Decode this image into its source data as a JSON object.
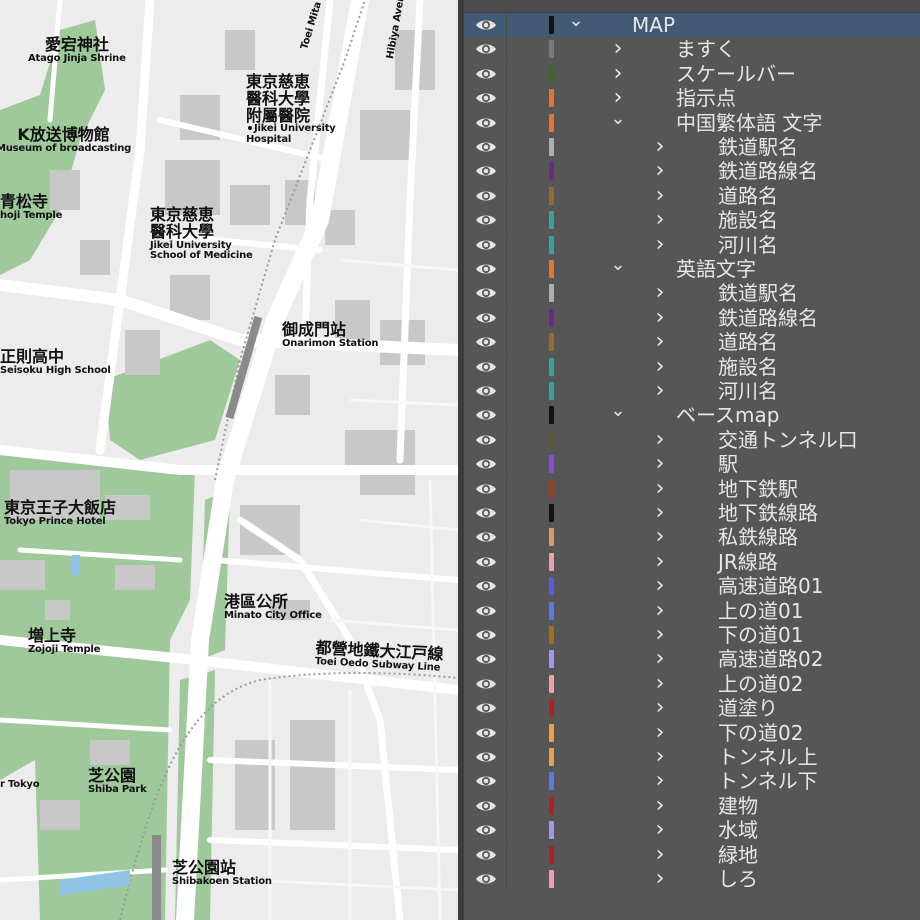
{
  "colors": {
    "panel_bg": "#565656",
    "selected_row": "#425a75",
    "map_bg": "#ececec",
    "park": "#9fc99a",
    "building": "#c8c8c8",
    "road": "#ffffff"
  },
  "map": {
    "labels": [
      {
        "id": "atago",
        "jp": "愛宕神社",
        "en": "Atago Jinja Shrine"
      },
      {
        "id": "broadcast",
        "jp": "K放送博物館",
        "en": "Museum of broadcasting"
      },
      {
        "id": "seishoji",
        "jp": "青松寺",
        "en": "hoji Temple"
      },
      {
        "id": "jikei_hosp",
        "jp": "東京慈恵\n醫科大學\n附屬醫院",
        "en": "Jikei University\nHospital"
      },
      {
        "id": "jikei_med",
        "jp": "東京慈恵\n醫科大學",
        "en": "Jikei University\nSchool of Medicine"
      },
      {
        "id": "seisoku",
        "jp": "正則高中",
        "en": "Seisoku High School"
      },
      {
        "id": "onarimon",
        "jp": "御成門站",
        "en": "Onarimon Station"
      },
      {
        "id": "prince",
        "jp": "東京王子大飯店",
        "en": "Tokyo Prince Hotel"
      },
      {
        "id": "minato",
        "jp": "港區公所",
        "en": "Minato City Office"
      },
      {
        "id": "oedo",
        "jp": "都營地鐵大江戸線",
        "en": "Toei Oedo Subway Line"
      },
      {
        "id": "zojoji",
        "jp": "増上寺",
        "en": "Zojoji Temple"
      },
      {
        "id": "shibapark",
        "jp": "芝公園",
        "en": "Shiba Park"
      },
      {
        "id": "rtokyo",
        "jp": "",
        "en": "r Tokyo"
      },
      {
        "id": "shibakoen",
        "jp": "芝公園站",
        "en": "Shibakoen Station"
      }
    ],
    "rotated": {
      "mita": "Toei Mita Subway Line",
      "hibiya": "Hibiya Avenue"
    }
  },
  "layers": [
    {
      "name": "MAP",
      "level": 0,
      "expanded": true,
      "color": "#111111",
      "selected": true
    },
    {
      "name": "ますく",
      "level": 1,
      "expanded": false,
      "color": "#7a7a7a"
    },
    {
      "name": "スケールバー",
      "level": 1,
      "expanded": false,
      "color": "#3c6a24"
    },
    {
      "name": "指示点",
      "level": 1,
      "expanded": false,
      "color": "#e8732c"
    },
    {
      "name": "中国繁体語 文字",
      "level": 1,
      "expanded": true,
      "color": "#e8732c"
    },
    {
      "name": "鉄道駅名",
      "level": 2,
      "expanded": false,
      "color": "#b0b0b0"
    },
    {
      "name": "鉄道路線名",
      "level": 2,
      "expanded": false,
      "color": "#6a2a8a"
    },
    {
      "name": "道路名",
      "level": 2,
      "expanded": false,
      "color": "#9a6a2a"
    },
    {
      "name": "施設名",
      "level": 2,
      "expanded": false,
      "color": "#3aa0a0"
    },
    {
      "name": "河川名",
      "level": 2,
      "expanded": false,
      "color": "#3aa0a0"
    },
    {
      "name": "英語文字",
      "level": 1,
      "expanded": true,
      "color": "#e8732c"
    },
    {
      "name": "鉄道駅名",
      "level": 2,
      "expanded": false,
      "color": "#b0b0b0"
    },
    {
      "name": "鉄道路線名",
      "level": 2,
      "expanded": false,
      "color": "#6a2a8a"
    },
    {
      "name": "道路名",
      "level": 2,
      "expanded": false,
      "color": "#9a6a2a"
    },
    {
      "name": "施設名",
      "level": 2,
      "expanded": false,
      "color": "#3aa0a0"
    },
    {
      "name": "河川名",
      "level": 2,
      "expanded": false,
      "color": "#3aa0a0"
    },
    {
      "name": "ベースmap",
      "level": 1,
      "expanded": true,
      "color": "#111111"
    },
    {
      "name": "交通トンネル口",
      "level": 2,
      "expanded": false,
      "color": "#5a5a2a"
    },
    {
      "name": "駅",
      "level": 2,
      "expanded": false,
      "color": "#8a4ae8"
    },
    {
      "name": "地下鉄駅",
      "level": 2,
      "expanded": false,
      "color": "#a0401a"
    },
    {
      "name": "地下鉄線路",
      "level": 2,
      "expanded": false,
      "color": "#111111"
    },
    {
      "name": "私鉄線路",
      "level": 2,
      "expanded": false,
      "color": "#d89a6a"
    },
    {
      "name": "JR線路",
      "level": 2,
      "expanded": false,
      "color": "#f0a0a8"
    },
    {
      "name": "高速道路01",
      "level": 2,
      "expanded": false,
      "color": "#5a5ae8"
    },
    {
      "name": "上の道01",
      "level": 2,
      "expanded": false,
      "color": "#5a7ae8"
    },
    {
      "name": "下の道01",
      "level": 2,
      "expanded": false,
      "color": "#a0701a"
    },
    {
      "name": "高速道路02",
      "level": 2,
      "expanded": false,
      "color": "#9a9af0"
    },
    {
      "name": "上の道02",
      "level": 2,
      "expanded": false,
      "color": "#f0a0a8"
    },
    {
      "name": "道塗り",
      "level": 2,
      "expanded": false,
      "color": "#b02020"
    },
    {
      "name": "下の道02",
      "level": 2,
      "expanded": false,
      "color": "#f0a040"
    },
    {
      "name": "トンネル上",
      "level": 2,
      "expanded": false,
      "color": "#f0a040"
    },
    {
      "name": "トンネル下",
      "level": 2,
      "expanded": false,
      "color": "#5a7ae8"
    },
    {
      "name": "建物",
      "level": 2,
      "expanded": false,
      "color": "#b02020"
    },
    {
      "name": "水域",
      "level": 2,
      "expanded": false,
      "color": "#9a9af0"
    },
    {
      "name": "緑地",
      "level": 2,
      "expanded": false,
      "color": "#b02020"
    },
    {
      "name": "しろ",
      "level": 2,
      "expanded": false,
      "color": "#f0a0a8"
    }
  ]
}
